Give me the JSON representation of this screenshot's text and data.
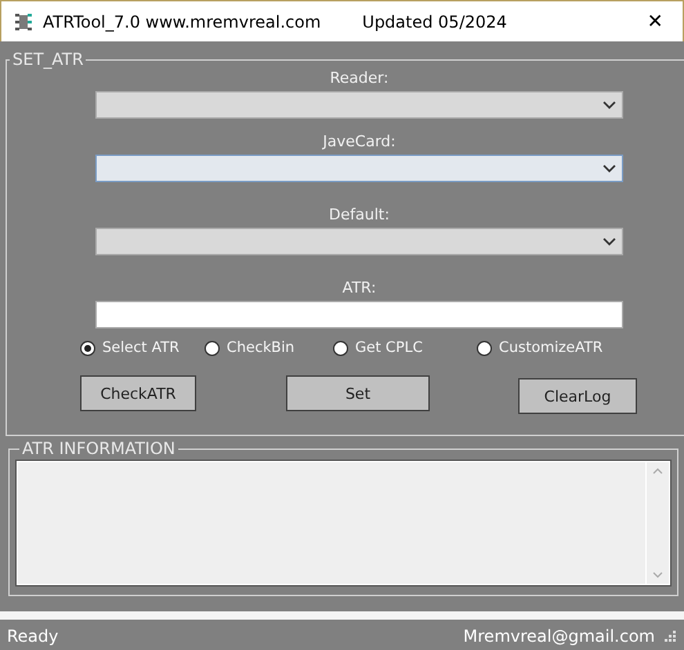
{
  "window": {
    "title": "ATRTool_7.0  www.mremvreal.com",
    "updated": "Updated  05/2024",
    "close": "✕"
  },
  "set_atr": {
    "legend": "SET_ATR",
    "fields": [
      {
        "label": "Reader:",
        "kind": "dropdown",
        "focused": false
      },
      {
        "label": "JaveCard:",
        "kind": "dropdown",
        "focused": true
      },
      {
        "label": "Default:",
        "kind": "dropdown",
        "focused": false
      },
      {
        "label": "ATR:",
        "kind": "text",
        "focused": false
      }
    ],
    "modes": [
      {
        "label": "Select ATR",
        "selected": true
      },
      {
        "label": "CheckBin",
        "selected": false
      },
      {
        "label": "Get CPLC",
        "selected": false
      },
      {
        "label": "CustomizeATR",
        "selected": false
      }
    ],
    "buttons": [
      "CheckATR",
      "Set",
      "ClearLog"
    ]
  },
  "atr_information": {
    "legend": "ATR INFORMATION"
  },
  "progress": {
    "level": 0
  },
  "status_bar": {
    "left": "Ready",
    "right": "Mremvreal@gmail.com"
  }
}
